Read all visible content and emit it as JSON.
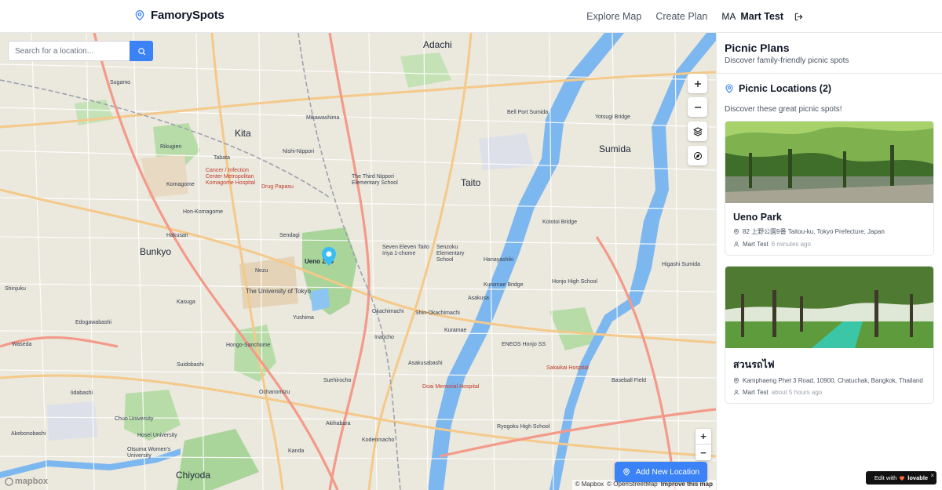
{
  "header": {
    "brand": "FamorySpots",
    "nav": {
      "explore": "Explore Map",
      "create": "Create Plan"
    },
    "user": {
      "initials": "MA",
      "name": "Mart Test"
    },
    "colors": {
      "accent": "#3b82f6"
    }
  },
  "map": {
    "search_placeholder": "Search for a location...",
    "add_button": "Add New Location",
    "attribution": {
      "mapbox": "© Mapbox",
      "osm": "© OpenStreetMap",
      "improve": "Improve this map"
    },
    "logo": "mapbox",
    "labels": {
      "adachi": "Adachi",
      "kita": "Kita",
      "sumida": "Sumida",
      "taito": "Taito",
      "bunkyo": "Bunkyo",
      "chiyoda": "Chiyoda",
      "ueno": "Ueno Zoo",
      "univ": "The University of Tokyo",
      "cancer": "Cancer / Infection Center Metropolitan Komagome Hospital",
      "drug": "Drug Papasu",
      "nippori": "The Third Nippori Elementary School",
      "seven": "Seven Eleven Taito Iriya 1-chome",
      "sanshu": "Senzoku Elementary School",
      "honjo": "Honjo High School",
      "eneos": "ENEOS Honjo SS",
      "sakai": "Sakaikai Hospital",
      "doai": "Doai Memorial Hospital",
      "ryogoku": "Ryogoku High School",
      "baseball": "Baseball Field",
      "higashi": "Higashi Sumida",
      "asakusa": "Asakusa",
      "kuramae": "Kuramae",
      "okachimachi": "Okachimachi",
      "asakusabashi": "Asakusabashi",
      "inaricho": "Inaricho",
      "kojimachi": "Kodenmacho",
      "shinokachi": "Shin-Okachimachi",
      "suehiro": "Suehirocho",
      "bellport": "Bell Port Sumida",
      "yotsugi": "Yotsugi Bridge",
      "kototoi": "Kototoi Bridge",
      "kuramaebr": "Kuramae Bridge",
      "hongo": "Hongo-Sanchome",
      "sugamo": "Sugamo",
      "edogawa": "Edogawabashi",
      "waseda": "Waseda",
      "otsuma": "Otsuma Women's University",
      "akebono": "Akebonobashi",
      "chuo": "Chuo University",
      "hosei": "Hosei University",
      "hanayashiki": "Hanayashiki",
      "mikawashima": "Mikawashima",
      "nishi": "Nishi-Nippori",
      "tabata": "Tabata",
      "komagome": "Komagome",
      "rikugien": "Rikugien",
      "hon": "Hon-Komagome",
      "hakusan": "Hakusan",
      "sendagi": "Sendagi",
      "nezu": "Nezu",
      "yushima": "Yushima",
      "kasuga": "Kasuga",
      "iidabashi": "Iidabashi",
      "suidobashi": "Suidobashi",
      "ochanomizu": "Ochanomizu",
      "akihabara": "Akihabara",
      "kanda": "Kanda",
      "shinjuku": "Shinjuku"
    }
  },
  "sidebar": {
    "title": "Picnic Plans",
    "subtitle": "Discover family-friendly picnic spots",
    "section_title": "Picnic Locations (2)",
    "section_desc": "Discover these great picnic spots!",
    "cards": [
      {
        "title": "Ueno Park",
        "address": "82 上野公園9番 Taitou-ku, Tokyo Prefecture, Japan",
        "author": "Mart Test",
        "time": "6 minutes ago"
      },
      {
        "title": "สวนรถไฟ",
        "address": "Kamphaeng Phet 3 Road, 10900, Chatuchak, Bangkok, Thailand",
        "author": "Mart Test",
        "time": "about 5 hours ago"
      }
    ]
  },
  "badge": {
    "text": "Edit with",
    "brand": "lovable",
    "close": "×"
  }
}
